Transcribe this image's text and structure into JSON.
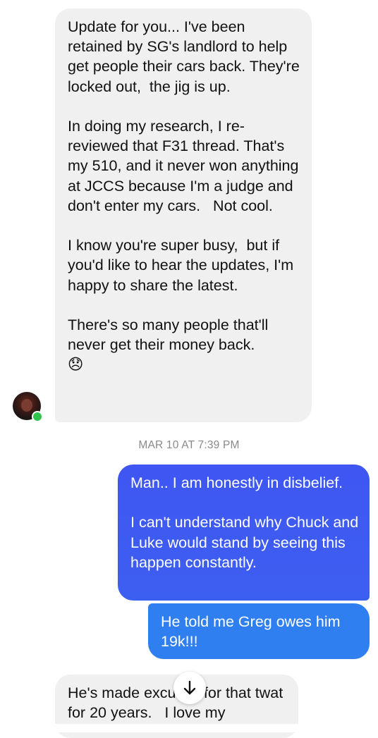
{
  "conversation": {
    "messages": [
      {
        "direction": "incoming",
        "text": "Update for you... I've been retained by SG's landlord to help get people their cars back. They're locked out,  the jig is up.\n\nIn doing my research, I re-reviewed that F31 thread. That's my 510, and it never won anything at JCCS because I'm a judge and don't enter my cars.   Not cool.\n\nI know you're super busy,  but if you'd like to hear the updates, I'm happy to share the latest.\n\nThere's so many people that'll never get their money back.\n😞"
      },
      {
        "direction": "outgoing",
        "text": "Man.. I am honestly in disbelief.\n\nI can't understand why Chuck and Luke would stand by seeing this happen constantly."
      },
      {
        "direction": "outgoing",
        "text": "He told me Greg owes him 19k!!!"
      },
      {
        "direction": "incoming",
        "text": "He's made excuses for that twat for 20 years.   I love my"
      }
    ],
    "timestamp": "MAR 10 AT 7:39 PM"
  },
  "contact": {
    "avatar_icon": "avatar-photo",
    "online_status": "online"
  },
  "scroll_button": {
    "icon": "arrow-down-icon"
  },
  "colors": {
    "incoming_bubble": "#f0f0f0",
    "outgoing_bubble_primary": "#3f56f2",
    "outgoing_bubble_secondary": "#2f7ff1",
    "timestamp_text": "#8a8a8a",
    "online_dot": "#31c24d"
  }
}
